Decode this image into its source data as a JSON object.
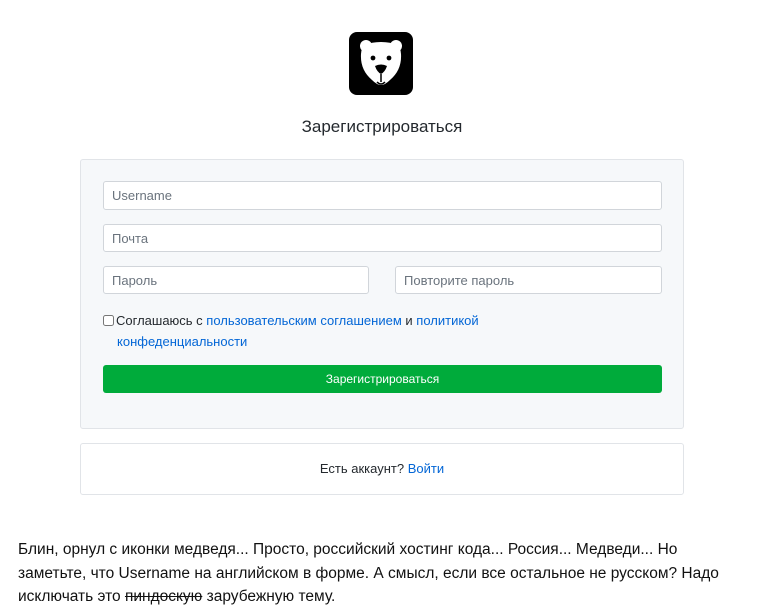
{
  "logo": {
    "icon": "bear-icon"
  },
  "page_title": "Зарегистрироваться",
  "form": {
    "username_placeholder": "Username",
    "email_placeholder": "Почта",
    "password_placeholder": "Пароль",
    "password_repeat_placeholder": "Повторите пароль",
    "agree_prefix": "Соглашаюсь с ",
    "agree_terms_link": "пользовательским соглашением",
    "agree_and": " и ",
    "agree_privacy_link_1": "политикой",
    "agree_privacy_link_2": "конфеденциальности",
    "submit_label": "Зарегистрироваться"
  },
  "login": {
    "text": "Есть аккаунт? ",
    "link": "Войти"
  },
  "comment": {
    "line1": "Блин, орнул с иконки медведя... Просто, российский хостинг кода... Россия... Медведи... Но",
    "line2": "заметьте, что Username на английском в форме. А смысл, если все остальное не русском? Надо",
    "line3_prefix": "исключать это ",
    "line3_strike": "пиндоскую",
    "line3_suffix": " зарубежную тему."
  },
  "colors": {
    "accent_green": "#00ab3b",
    "link_blue": "#0366d6"
  }
}
